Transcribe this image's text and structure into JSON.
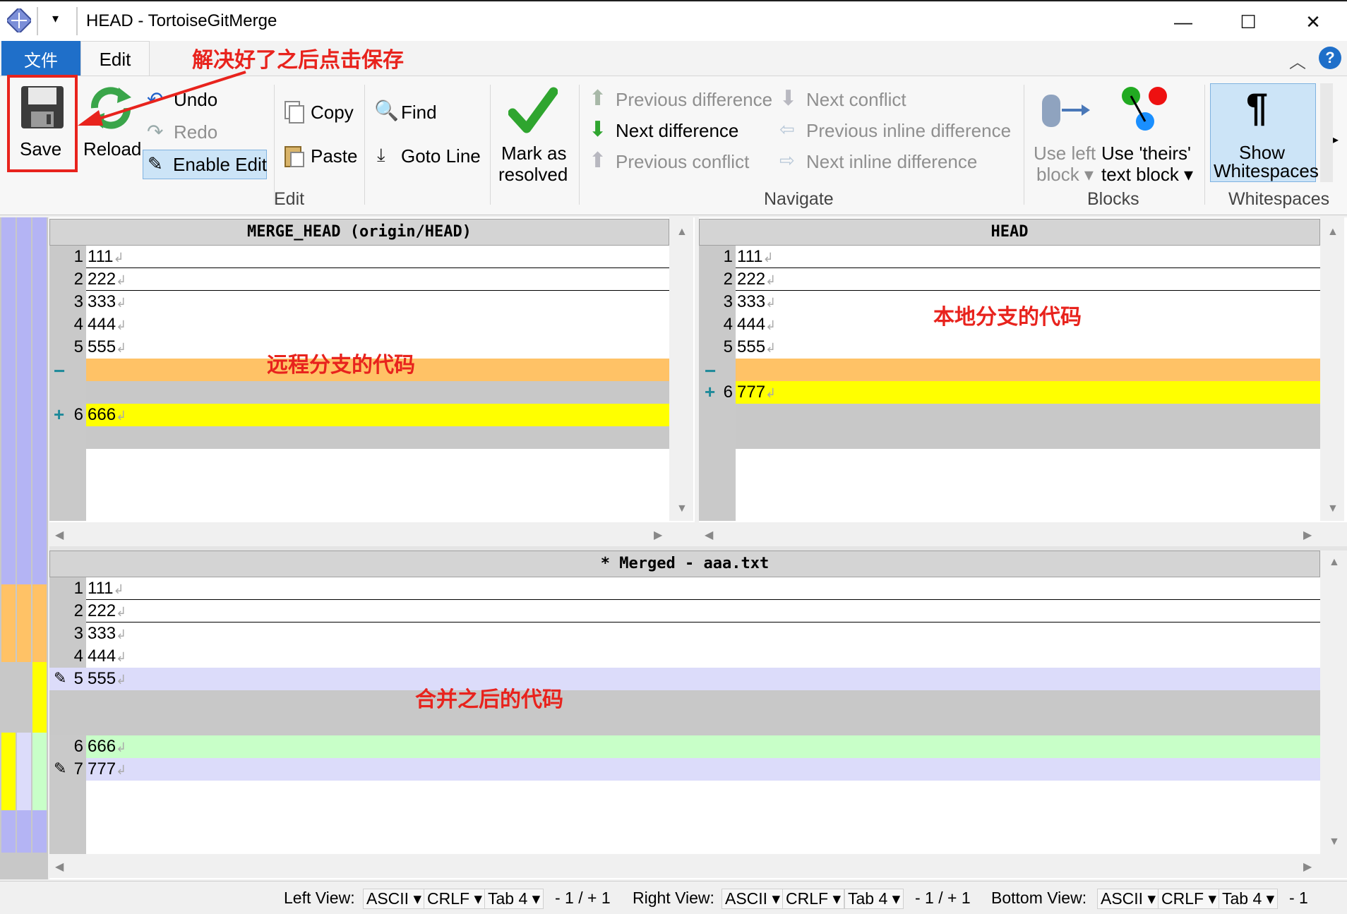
{
  "window": {
    "title": "HEAD - TortoiseGitMerge",
    "minimize_glyph": "—",
    "maximize_glyph": "☐",
    "close_glyph": "✕"
  },
  "tabs": {
    "file": "文件",
    "edit": "Edit"
  },
  "ribbon": {
    "save": "Save",
    "reload": "Reload",
    "undo": "Undo",
    "redo": "Redo",
    "enable_edit": "Enable Edit",
    "copy": "Copy",
    "paste": "Paste",
    "find": "Find",
    "goto_line": "Goto Line",
    "mark_as": "Mark as",
    "resolved": "resolved",
    "prev_diff": "Previous difference",
    "next_diff": "Next difference",
    "prev_conflict": "Previous conflict",
    "next_conflict": "Next conflict",
    "prev_inline": "Previous inline difference",
    "next_inline": "Next inline difference",
    "use_left": "Use left",
    "block": "block",
    "use_theirs": "Use 'theirs'",
    "text_block": "text block",
    "show": "Show",
    "whitespaces": "Whitespaces",
    "group_edit": "Edit",
    "group_navigate": "Navigate",
    "group_blocks": "Blocks",
    "group_whitespaces": "Whitespaces"
  },
  "left_pane": {
    "header": "MERGE_HEAD (origin/HEAD)",
    "lines": [
      {
        "n": "1",
        "t": "111"
      },
      {
        "n": "2",
        "t": "222"
      },
      {
        "n": "3",
        "t": "333"
      },
      {
        "n": "4",
        "t": "444"
      },
      {
        "n": "5",
        "t": "555"
      },
      {
        "n": "6",
        "t": "666"
      }
    ]
  },
  "right_pane": {
    "header": "HEAD",
    "lines": [
      {
        "n": "1",
        "t": "111"
      },
      {
        "n": "2",
        "t": "222"
      },
      {
        "n": "3",
        "t": "333"
      },
      {
        "n": "4",
        "t": "444"
      },
      {
        "n": "5",
        "t": "555"
      },
      {
        "n": "6",
        "t": "777"
      }
    ]
  },
  "bottom_pane": {
    "header": "* Merged - aaa.txt",
    "lines": [
      {
        "n": "1",
        "t": "111"
      },
      {
        "n": "2",
        "t": "222"
      },
      {
        "n": "3",
        "t": "333"
      },
      {
        "n": "4",
        "t": "444"
      },
      {
        "n": "5",
        "t": "555"
      },
      {
        "n": "6",
        "t": "666"
      },
      {
        "n": "7",
        "t": "777"
      }
    ]
  },
  "annotations": {
    "save_hint": "解决好了之后点击保存",
    "remote": "远程分支的代码",
    "local": "本地分支的代码",
    "merged": "合并之后的代码"
  },
  "statusbar": {
    "left_view": "Left View:",
    "right_view": "Right View:",
    "bottom_view": "Bottom View:",
    "encoding": "ASCII",
    "eol": "CRLF",
    "tab": "Tab 4",
    "diff_count": "- 1 / + 1",
    "bottom_count": "- 1"
  },
  "colors": {
    "removed": "#ffc266",
    "added": "#ffff00",
    "empty": "#c8c8c8",
    "edited": "#dcdcfa",
    "merged_add": "#c8ffc8",
    "annotation": "#e8231d",
    "file_tab": "#1f6fc9"
  },
  "icons": [
    "save-icon",
    "reload-icon",
    "undo-icon",
    "redo-icon",
    "copy-icon",
    "paste-icon",
    "find-icon",
    "goto-icon",
    "checkmark-icon",
    "arrow-up-icon",
    "arrow-down-icon",
    "pilcrow-icon",
    "help-icon",
    "pencil-icon"
  ]
}
